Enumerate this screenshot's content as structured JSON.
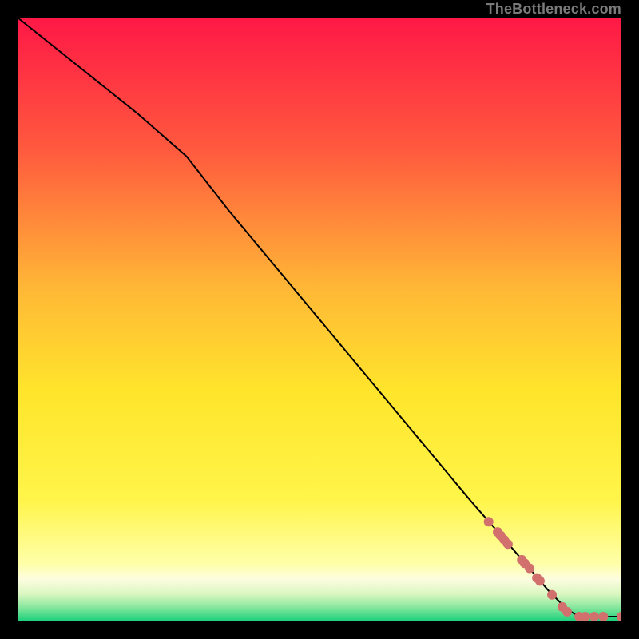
{
  "watermark": "TheBottleneck.com",
  "chart_data": {
    "type": "line",
    "title": "",
    "xlabel": "",
    "ylabel": "",
    "xlim": [
      0,
      100
    ],
    "ylim": [
      0,
      100
    ],
    "grid": false,
    "legend": false,
    "background_gradient": {
      "top_color": "#ff1846",
      "mid_top_color": "#ff7a3a",
      "mid_color": "#ffe52b",
      "mid_bottom_color": "#fff9b0",
      "bottom_color": "#17e07a"
    },
    "gradient_stops": [
      {
        "offset": 0.0,
        "color": "#ff1846"
      },
      {
        "offset": 0.22,
        "color": "#ff5a3e"
      },
      {
        "offset": 0.45,
        "color": "#ffb836"
      },
      {
        "offset": 0.62,
        "color": "#ffe52b"
      },
      {
        "offset": 0.8,
        "color": "#fff54a"
      },
      {
        "offset": 0.905,
        "color": "#ffffaa"
      },
      {
        "offset": 0.93,
        "color": "#fdfde0"
      },
      {
        "offset": 0.955,
        "color": "#d9f6c0"
      },
      {
        "offset": 0.975,
        "color": "#8ee9a0"
      },
      {
        "offset": 1.0,
        "color": "#17d07a"
      }
    ],
    "series": [
      {
        "name": "curve",
        "type": "line",
        "color": "#000000",
        "stroke_width": 2,
        "x": [
          0,
          10,
          20,
          28,
          35,
          45,
          55,
          65,
          75,
          82,
          88,
          91,
          93,
          95,
          100
        ],
        "y": [
          100,
          92,
          84,
          77,
          68,
          56,
          44,
          32,
          20,
          12,
          5,
          2,
          0.8,
          0.8,
          0.8
        ]
      },
      {
        "name": "dots",
        "type": "scatter",
        "color": "#d1706c",
        "radius": 6,
        "x": [
          78.0,
          79.5,
          80.0,
          80.6,
          81.2,
          83.5,
          84.0,
          84.8,
          86.0,
          86.5,
          88.5,
          90.2,
          91.0,
          93.0,
          94.0,
          95.5,
          97.0,
          100.0
        ],
        "y": [
          16.5,
          14.8,
          14.2,
          13.5,
          12.8,
          10.2,
          9.6,
          8.8,
          7.2,
          6.7,
          4.4,
          2.4,
          1.6,
          0.8,
          0.8,
          0.8,
          0.8,
          0.8
        ]
      }
    ]
  }
}
